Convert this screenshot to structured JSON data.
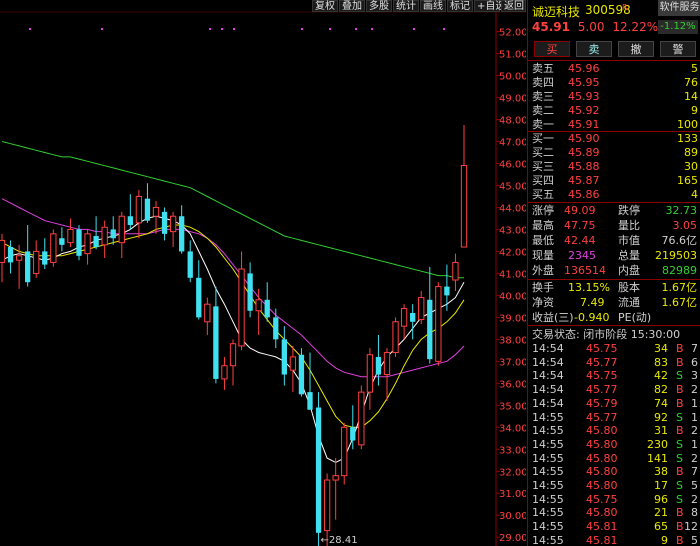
{
  "toolbar": {
    "buttons": [
      "复权",
      "叠加",
      "多股",
      "统计",
      "画线",
      "标记",
      "+自选",
      "返回"
    ]
  },
  "stock": {
    "name": "诚迈科技",
    "code": "300598",
    "flag": "R",
    "price": "45.91",
    "change": "5.00",
    "change_pct": "12.22%",
    "software_label": "软件服务",
    "sector_pct": "-1.12%"
  },
  "actions": {
    "buy": "买",
    "sell": "卖",
    "cancel": "撤",
    "alert": "警"
  },
  "asks": [
    {
      "label": "卖五",
      "price": "45.96",
      "vol": "5"
    },
    {
      "label": "卖四",
      "price": "45.95",
      "vol": "76"
    },
    {
      "label": "卖三",
      "price": "45.93",
      "vol": "14"
    },
    {
      "label": "卖二",
      "price": "45.92",
      "vol": "9"
    },
    {
      "label": "卖一",
      "price": "45.91",
      "vol": "100"
    }
  ],
  "bids": [
    {
      "label": "买一",
      "price": "45.90",
      "vol": "133"
    },
    {
      "label": "买二",
      "price": "45.89",
      "vol": "89"
    },
    {
      "label": "买三",
      "price": "45.88",
      "vol": "30"
    },
    {
      "label": "买四",
      "price": "45.87",
      "vol": "165"
    },
    {
      "label": "买五",
      "price": "45.86",
      "vol": "4"
    }
  ],
  "quote": {
    "limit_up_label": "涨停",
    "limit_up": "49.09",
    "limit_down_label": "跌停",
    "limit_down": "32.73",
    "high_label": "最高",
    "high": "47.75",
    "vol_ratio_label": "量比",
    "vol_ratio": "3.05",
    "low_label": "最低",
    "low": "42.44",
    "mkt_cap_label": "市值",
    "mkt_cap": "76.6亿",
    "cur_vol_label": "现量",
    "cur_vol": "2345",
    "total_vol_label": "总量",
    "total_vol": "219503",
    "outer_label": "外盘",
    "outer": "136514",
    "inner_label": "内盘",
    "inner": "82989",
    "turnover_label": "换手",
    "turnover": "13.15%",
    "equity_label": "股本",
    "equity": "1.67亿",
    "nav_label": "净资",
    "nav": "7.49",
    "float_label": "流通",
    "float": "1.67亿",
    "eps_label": "收益(三)",
    "eps": "-0.940",
    "pe_label": "PE(动)",
    "pe": ""
  },
  "trade_status": "交易状态: 闭市阶段 15:30:00",
  "trades": [
    {
      "t": "14:54",
      "p": "45.75",
      "v": "34",
      "bs": "B",
      "n": "7"
    },
    {
      "t": "14:54",
      "p": "45.77",
      "v": "83",
      "bs": "B",
      "n": "6"
    },
    {
      "t": "14:54",
      "p": "45.75",
      "v": "42",
      "bs": "S",
      "n": "3"
    },
    {
      "t": "14:54",
      "p": "45.77",
      "v": "82",
      "bs": "B",
      "n": "2"
    },
    {
      "t": "14:54",
      "p": "45.79",
      "v": "74",
      "bs": "B",
      "n": "1"
    },
    {
      "t": "14:55",
      "p": "45.77",
      "v": "92",
      "bs": "S",
      "n": "1"
    },
    {
      "t": "14:55",
      "p": "45.80",
      "v": "31",
      "bs": "B",
      "n": "2"
    },
    {
      "t": "14:55",
      "p": "45.80",
      "v": "230",
      "bs": "S",
      "n": "1"
    },
    {
      "t": "14:55",
      "p": "45.80",
      "v": "141",
      "bs": "S",
      "n": "2"
    },
    {
      "t": "14:55",
      "p": "45.80",
      "v": "38",
      "bs": "B",
      "n": "7"
    },
    {
      "t": "14:55",
      "p": "45.80",
      "v": "17",
      "bs": "S",
      "n": "5"
    },
    {
      "t": "14:55",
      "p": "45.75",
      "v": "96",
      "bs": "S",
      "n": "2"
    },
    {
      "t": "14:55",
      "p": "45.80",
      "v": "21",
      "bs": "B",
      "n": "8"
    },
    {
      "t": "14:55",
      "p": "45.81",
      "v": "65",
      "bs": "B",
      "n": "12"
    },
    {
      "t": "14:55",
      "p": "45.81",
      "v": "9",
      "bs": "B",
      "n": "5"
    }
  ],
  "colors": {
    "up": "#ff4040",
    "down": "#40e0f0",
    "ma5": "#ffffff",
    "ma10": "#e8e800",
    "ma20": "#e040e0",
    "ma60": "#30d030"
  },
  "chart_data": {
    "type": "candlestick",
    "y_ticks": [
      "52.00",
      "51.00",
      "50.00",
      "49.00",
      "48.00",
      "47.00",
      "46.00",
      "45.00",
      "44.00",
      "43.00",
      "42.00",
      "41.00",
      "40.00",
      "39.00",
      "38.00",
      "37.00",
      "36.00",
      "35.00",
      "34.00",
      "33.00",
      "32.00",
      "31.00",
      "30.00",
      "29.00"
    ],
    "ylim": [
      28.6,
      52.8
    ],
    "min_label": "28.41",
    "candles": [
      [
        41.5,
        42.8,
        40.6,
        42.5
      ],
      [
        42.2,
        42.5,
        41.0,
        41.5
      ],
      [
        41.6,
        42.3,
        40.3,
        41.8
      ],
      [
        42.0,
        43.2,
        40.4,
        40.6
      ],
      [
        41.0,
        42.5,
        40.8,
        42.0
      ],
      [
        42.0,
        42.6,
        41.2,
        41.4
      ],
      [
        41.5,
        43.0,
        41.3,
        42.8
      ],
      [
        42.6,
        43.1,
        42.0,
        42.3
      ],
      [
        42.4,
        43.5,
        42.2,
        43.0
      ],
      [
        43.0,
        43.2,
        41.6,
        41.8
      ],
      [
        41.9,
        43.0,
        41.4,
        42.8
      ],
      [
        42.7,
        43.6,
        42.1,
        42.2
      ],
      [
        42.3,
        43.4,
        41.7,
        43.1
      ],
      [
        43.0,
        43.6,
        42.3,
        42.6
      ],
      [
        42.4,
        43.8,
        41.7,
        43.6
      ],
      [
        43.6,
        44.6,
        43.0,
        43.2
      ],
      [
        43.3,
        44.8,
        42.6,
        44.5
      ],
      [
        44.4,
        45.1,
        43.3,
        43.4
      ],
      [
        43.6,
        44.3,
        42.8,
        44.0
      ],
      [
        43.8,
        44.0,
        42.5,
        42.8
      ],
      [
        42.9,
        43.8,
        42.2,
        43.6
      ],
      [
        43.6,
        44.1,
        41.9,
        42.0
      ],
      [
        42.0,
        42.5,
        40.6,
        40.8
      ],
      [
        40.8,
        41.6,
        38.9,
        39.0
      ],
      [
        38.8,
        39.9,
        38.2,
        39.6
      ],
      [
        39.5,
        40.4,
        36.0,
        36.2
      ],
      [
        36.2,
        37.2,
        35.7,
        36.8
      ],
      [
        36.8,
        38.0,
        35.9,
        37.8
      ],
      [
        37.7,
        42.0,
        37.5,
        41.2
      ],
      [
        41.0,
        41.5,
        39.0,
        39.3
      ],
      [
        39.3,
        40.3,
        38.2,
        39.8
      ],
      [
        39.8,
        40.6,
        38.8,
        39.0
      ],
      [
        39.0,
        39.4,
        37.6,
        38.0
      ],
      [
        38.0,
        38.6,
        35.9,
        36.4
      ],
      [
        36.6,
        37.7,
        35.6,
        37.2
      ],
      [
        37.3,
        37.6,
        35.4,
        35.5
      ],
      [
        35.6,
        37.4,
        34.8,
        34.8
      ],
      [
        34.9,
        35.6,
        28.4,
        29.2
      ],
      [
        29.3,
        31.9,
        28.4,
        31.6
      ],
      [
        31.6,
        32.6,
        29.8,
        31.8
      ],
      [
        31.8,
        34.2,
        31.4,
        34.0
      ],
      [
        34.0,
        35.0,
        33.0,
        33.4
      ],
      [
        33.2,
        35.9,
        33.0,
        35.6
      ],
      [
        35.6,
        37.6,
        34.8,
        37.3
      ],
      [
        37.2,
        38.2,
        35.9,
        36.4
      ],
      [
        36.4,
        37.6,
        35.2,
        37.4
      ],
      [
        37.4,
        39.0,
        37.2,
        38.8
      ],
      [
        38.6,
        39.6,
        38.0,
        39.4
      ],
      [
        39.2,
        39.6,
        38.0,
        38.8
      ],
      [
        38.9,
        40.2,
        38.7,
        39.9
      ],
      [
        39.8,
        41.3,
        36.9,
        37.1
      ],
      [
        37.0,
        40.6,
        36.8,
        40.4
      ],
      [
        40.4,
        41.4,
        39.3,
        40.0
      ],
      [
        40.7,
        41.9,
        40.2,
        41.5
      ],
      [
        42.2,
        47.75,
        42.44,
        45.91
      ]
    ],
    "ma5": [
      41.6,
      41.8,
      41.9,
      41.8,
      41.7,
      41.6,
      41.7,
      41.9,
      42.0,
      42.2,
      42.3,
      42.5,
      42.6,
      42.7,
      42.8,
      43.0,
      43.3,
      43.5,
      43.6,
      43.5,
      43.4,
      43.2,
      42.8,
      42.0,
      41.2,
      40.3,
      39.6,
      38.8,
      38.0,
      37.6,
      37.4,
      37.3,
      37.2,
      37.0,
      36.6,
      36.0,
      35.0,
      33.6,
      32.6,
      32.4,
      32.6,
      33.5,
      34.6,
      35.8,
      36.6,
      37.2,
      37.6,
      38.0,
      38.5,
      39.0,
      39.2,
      39.4,
      39.6,
      39.9,
      40.6
    ],
    "ma10": [
      42.4,
      42.2,
      42.0,
      41.9,
      41.8,
      41.8,
      41.8,
      41.8,
      41.9,
      42.0,
      42.1,
      42.2,
      42.3,
      42.4,
      42.5,
      42.6,
      42.7,
      42.8,
      43.0,
      43.1,
      43.2,
      43.2,
      43.1,
      42.9,
      42.6,
      42.2,
      41.7,
      41.2,
      40.6,
      40.0,
      39.4,
      38.9,
      38.4,
      38.0,
      37.6,
      37.2,
      36.6,
      35.9,
      35.2,
      34.5,
      34.1,
      34.0,
      34.0,
      34.3,
      34.7,
      35.3,
      36.0,
      36.8,
      37.5,
      38.0,
      38.3,
      38.5,
      38.8,
      39.2,
      39.8
    ],
    "ma20": [
      44.4,
      44.2,
      44.0,
      43.8,
      43.6,
      43.4,
      43.3,
      43.2,
      43.1,
      43.0,
      43.0,
      42.9,
      42.9,
      42.8,
      42.8,
      42.8,
      42.8,
      42.8,
      42.9,
      43.0,
      43.0,
      43.0,
      42.9,
      42.8,
      42.6,
      42.3,
      41.9,
      41.4,
      40.9,
      40.4,
      39.9,
      39.5,
      39.1,
      38.8,
      38.5,
      38.2,
      37.8,
      37.4,
      37.0,
      36.7,
      36.5,
      36.4,
      36.3,
      36.3,
      36.3,
      36.3,
      36.4,
      36.5,
      36.6,
      36.7,
      36.8,
      36.9,
      37.0,
      37.3,
      37.7
    ],
    "ma60": [
      47.0,
      46.9,
      46.8,
      46.7,
      46.6,
      46.5,
      46.4,
      46.3,
      46.3,
      46.2,
      46.1,
      46.0,
      45.9,
      45.8,
      45.7,
      45.6,
      45.5,
      45.4,
      45.3,
      45.2,
      45.1,
      45.0,
      44.9,
      44.7,
      44.5,
      44.3,
      44.1,
      43.9,
      43.7,
      43.5,
      43.3,
      43.1,
      42.9,
      42.7,
      42.6,
      42.5,
      42.4,
      42.3,
      42.2,
      42.1,
      42.0,
      41.9,
      41.8,
      41.7,
      41.6,
      41.5,
      41.4,
      41.3,
      41.2,
      41.1,
      41.0,
      40.9,
      40.9,
      40.8,
      40.8
    ]
  }
}
